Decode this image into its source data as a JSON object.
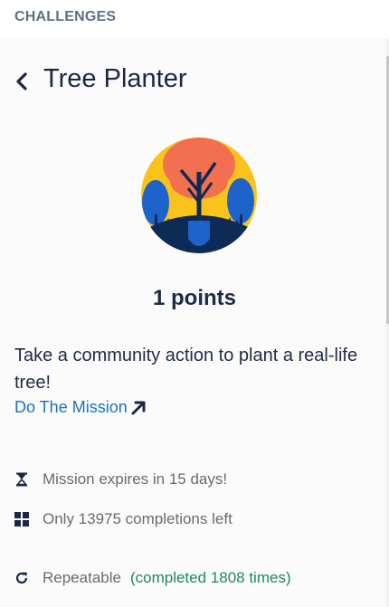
{
  "header": {
    "section_title": "CHALLENGES"
  },
  "challenge": {
    "title": "Tree Planter",
    "points_label": "1 points",
    "description": "Take a community action to plant a real-life tree!",
    "mission_link_label": "Do The Mission",
    "expires_text": "Mission expires in 15 days!",
    "completions_text": "Only 13975 completions left",
    "repeatable_label": "Repeatable",
    "completed_text": "(completed 1808 times)"
  },
  "icons": {
    "back": "chevron-left-icon",
    "external": "arrow-up-right-icon",
    "expires": "hourglass-icon",
    "completions": "grid-icon",
    "repeatable": "refresh-icon",
    "badge": "tree-planter-badge"
  },
  "colors": {
    "link": "#1e73b8",
    "completed": "#1e8a5c",
    "badge_sun": "#f9c31c",
    "badge_tree": "#f26f4f",
    "badge_blue": "#1e63c9",
    "badge_ground": "#0e2a57"
  }
}
